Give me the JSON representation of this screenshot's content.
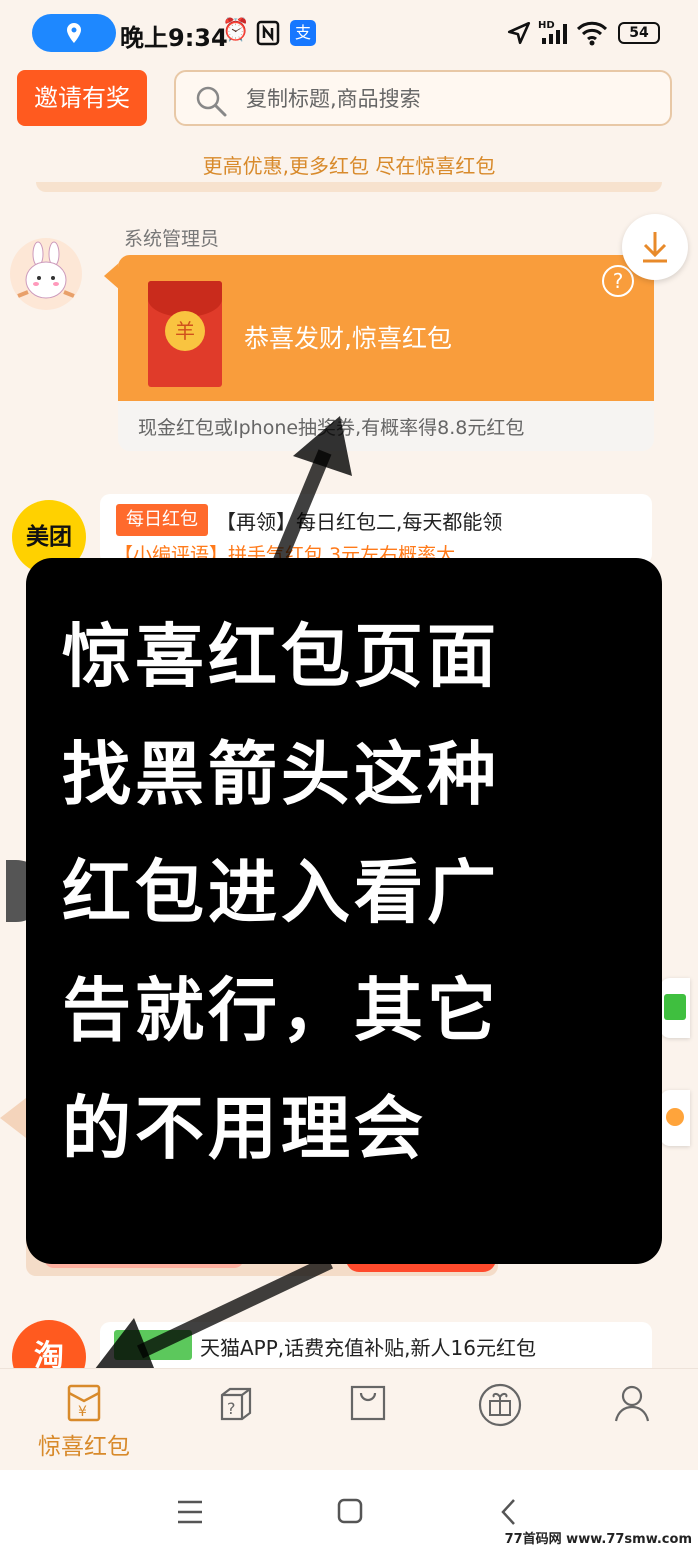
{
  "status_bar": {
    "time": "晚上9:34",
    "battery": "54",
    "alipay_glyph": "支",
    "icons": [
      "location-icon",
      "alarm-icon",
      "nfc-icon",
      "alipay-icon",
      "navigation-icon",
      "hd-signal-icon",
      "wifi-icon",
      "battery-icon"
    ]
  },
  "header": {
    "invite_label": "邀请有奖",
    "search_placeholder": "复制标题,商品搜索",
    "tagline": "更高优惠,更多红包 尽在惊喜红包"
  },
  "message": {
    "sender": "系统管理员",
    "title": "恭喜发财,惊喜红包",
    "help": "?",
    "coin": "羊",
    "description": "现金红包或Iphone抽奖券,有概率得8.8元红包"
  },
  "list": [
    {
      "logo": "美团",
      "badge": "每日红包",
      "title": "【再领】每日红包二,每天都能领",
      "subtitle": "【小编评语】拼手气红包,3元左右概率大"
    },
    {
      "logo": "淘",
      "title": "天猫APP,话费充值补贴,新人16元红包"
    }
  ],
  "overlay": {
    "lines": [
      "惊喜红包页面",
      "找黑箭头这种",
      "红包进入看广",
      "告就行，其它",
      "的不用理会"
    ]
  },
  "tab_bar": {
    "tabs": [
      {
        "label": "惊喜红包",
        "icon": "red-envelope-icon",
        "active": true
      },
      {
        "label": "",
        "icon": "mystery-box-icon",
        "active": false
      },
      {
        "label": "",
        "icon": "shopping-bag-icon",
        "active": false
      },
      {
        "label": "",
        "icon": "gift-icon",
        "active": false
      },
      {
        "label": "",
        "icon": "profile-icon",
        "active": false
      }
    ]
  },
  "watermark": "77首码网 www.77smw.com",
  "colors": {
    "accent": "#ff5a1f",
    "orange_card": "#f99d3c",
    "tab_active": "#d88a2b",
    "background": "#fbf3ec"
  }
}
